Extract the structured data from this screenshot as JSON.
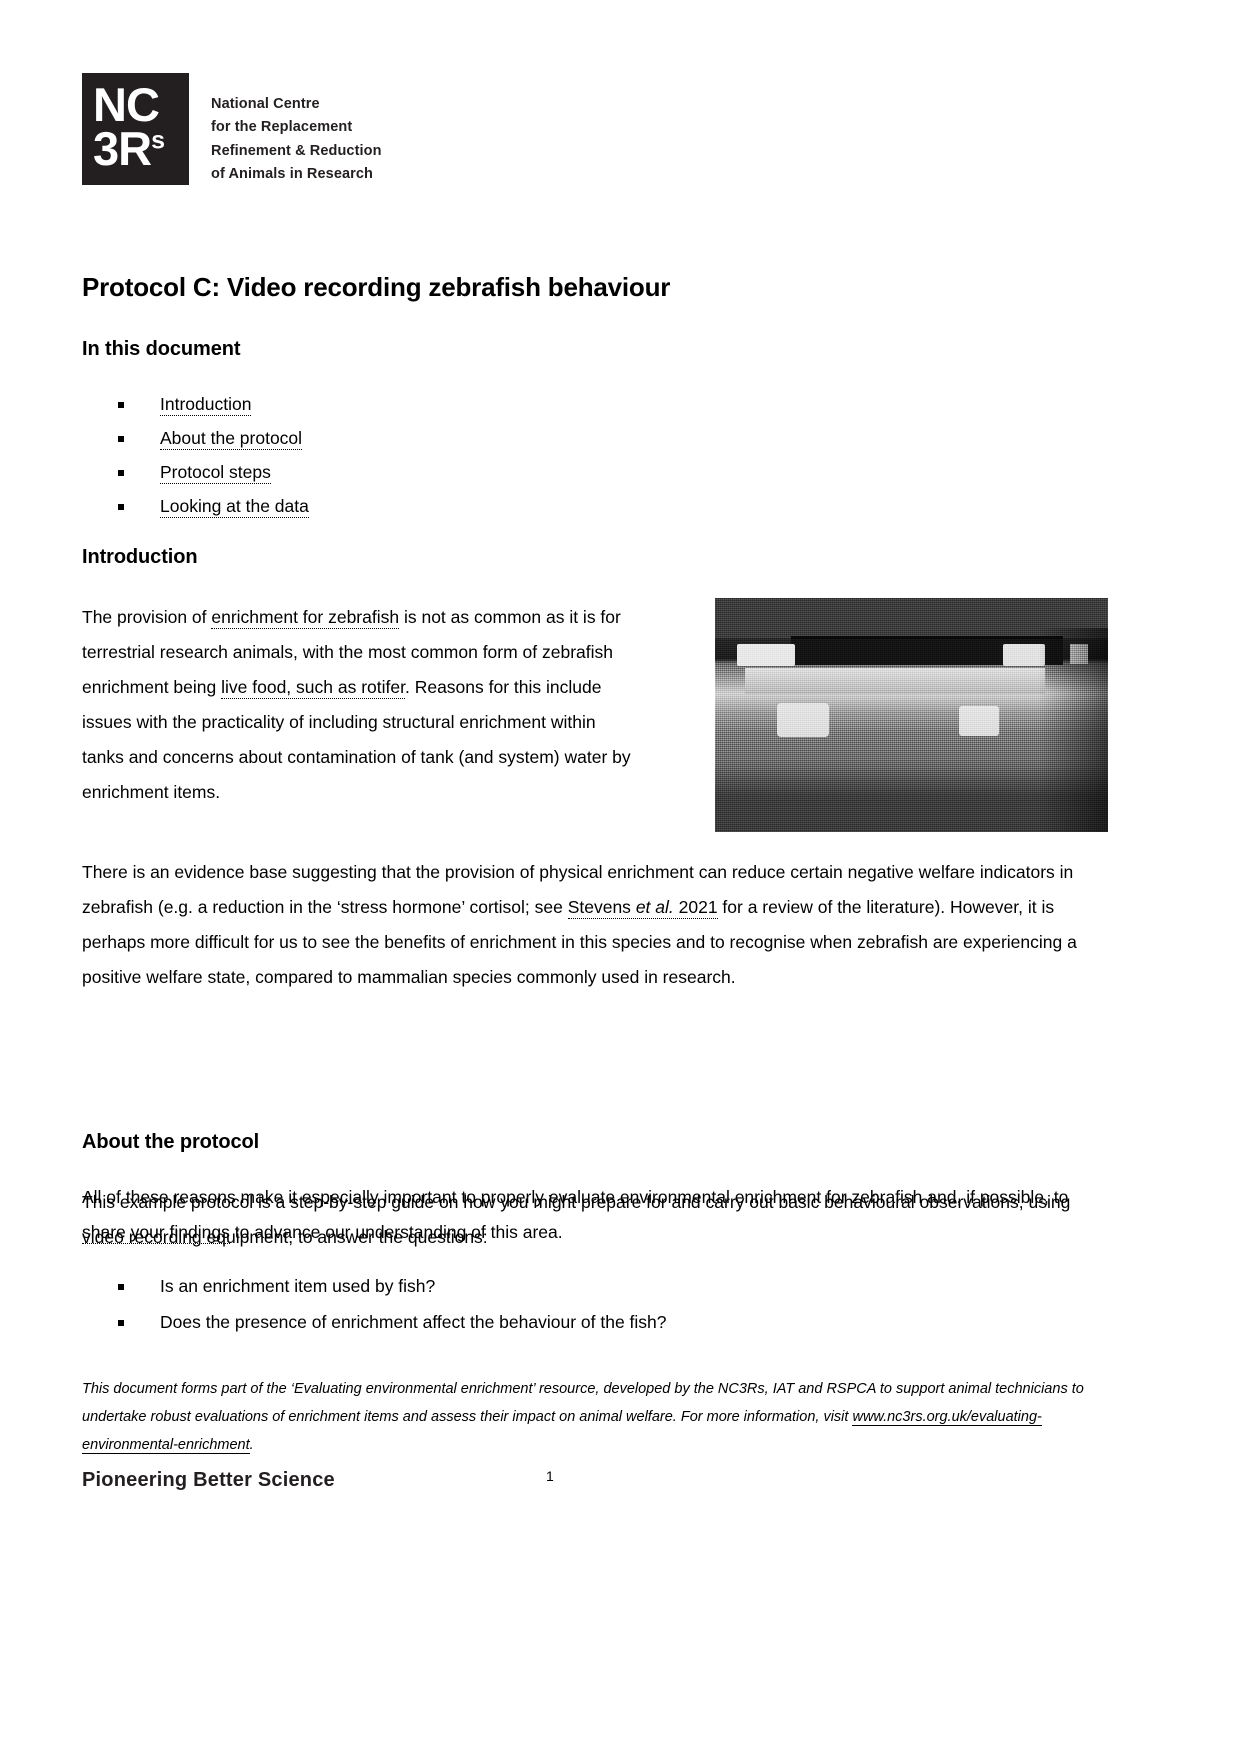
{
  "logo": {
    "mark_line1": "NC",
    "mark_line2": "3R",
    "mark_superscript": "s",
    "name_lines": [
      "National Centre",
      "for the Replacement",
      "Refinement & Reduction",
      "of Animals in Research"
    ],
    "tagline": "Pioneering Better Science"
  },
  "document": {
    "title": "Protocol C: Video recording zebrafish behaviour",
    "page_number": "1"
  },
  "in_this_document": {
    "heading": "In this document",
    "links": [
      "Introduction",
      "About the protocol",
      "Protocol steps",
      "Looking at the data"
    ]
  },
  "introduction": {
    "heading": "Introduction",
    "para1_pre": "The provision of ",
    "para1_link1": "enrichment for zebrafish",
    "para1_mid": " is not as common as it is for terrestrial research animals, with the most common form of zebrafish enrichment being ",
    "para1_link2": "live food, such as rotifer",
    "para1_post": ". Reasons for this include issues with the practicality of including structural enrichment within tanks and concerns about contamination of tank (and system) water by enrichment items.",
    "para2_pre": "There is an evidence base suggesting that the provision of physical enrichment can reduce certain negative welfare indicators in zebrafish (e.g. a reduction in the ‘stress hormone’ cortisol; see ",
    "para2_link": "Stevens et al. 2021",
    "para2_link_italic": "et al.",
    "para2_post": " for a review of the literature). However, it is perhaps more difficult for us to see the benefits of enrichment in this species and to recognise when zebrafish are experiencing a positive welfare state, compared to mammalian species commonly used in research.",
    "para3_pre": "All of these reasons make it especially important to properly evaluate environmental enrichment for zebrafish and, if possible, to ",
    "para3_link": "share your findings",
    "para3_post": " to advance our understanding of this area.",
    "photo_caption": "zebrafish-tank-photo"
  },
  "about_the_protocol": {
    "heading": "About the protocol",
    "intro": "This example protocol is a step-by-step guide on how you might prepare for and carry out basic behavioural observations, using video recording equipment, to answer the questions:",
    "questions": [
      "Is an enrichment item used by fish?",
      "Does the presence of enrichment affect the behaviour of the fish?"
    ]
  },
  "footnote": {
    "pre": "This document forms part of the ‘Evaluating environmental enrichment’ resource, developed by the NC3Rs, IAT and RSPCA to support animal technicians to undertake robust evaluations of enrichment items and assess their impact on animal welfare. For more information, visit ",
    "url": "www.nc3rs.org.uk/evaluating-environmental-enrichment",
    "post": "."
  }
}
